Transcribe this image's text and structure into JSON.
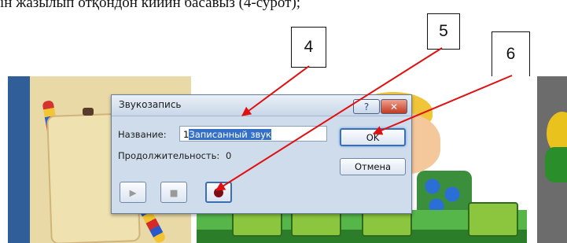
{
  "doc": {
    "top_line": "ін жазылып отқондон кийин басавыз (4-сурот);"
  },
  "callouts": [
    "4",
    "5",
    "6"
  ],
  "dialog": {
    "title": "Звукозапись",
    "help_label": "?",
    "close_label": "✕",
    "name_label": "Название:",
    "name_value_prefix": "1",
    "name_value_selected": "Записанный звук",
    "duration_label": "Продолжительность:",
    "duration_value": "0",
    "ok_label": "OK",
    "cancel_label": "Отмена",
    "play_icon": "▶",
    "stop_icon": "■"
  },
  "colors": {
    "arrow": "#e01010",
    "dialog_bg": "#cfdceb",
    "record_dot": "#7d0f14"
  }
}
